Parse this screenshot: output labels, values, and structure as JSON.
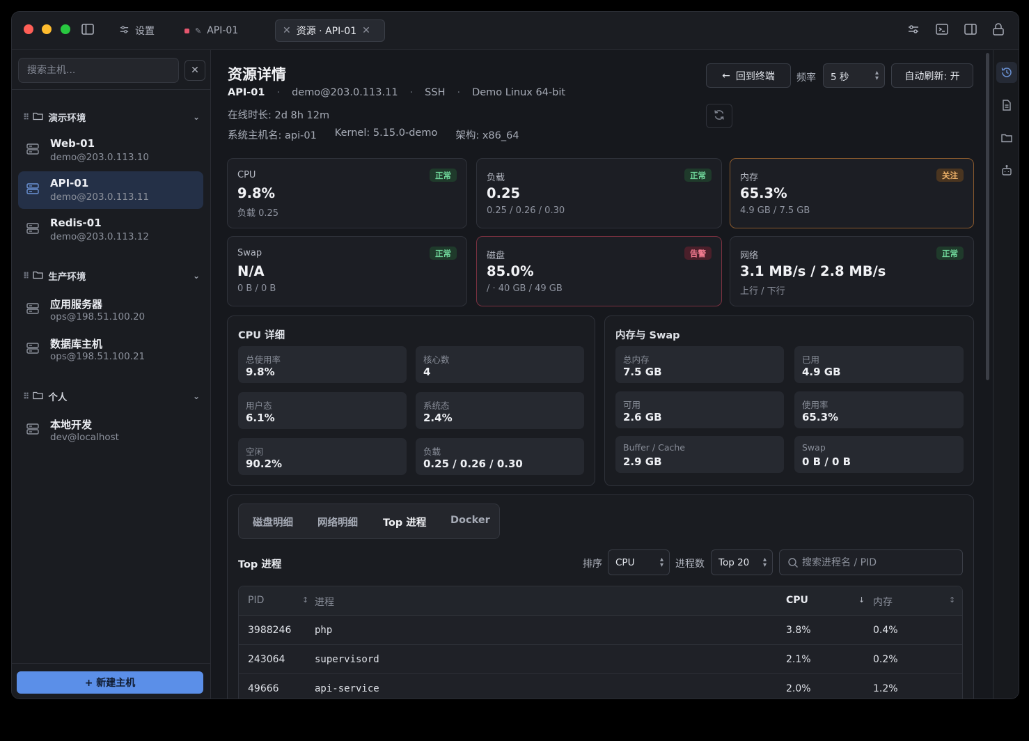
{
  "titlebar": {
    "tabs": [
      {
        "label": "设置"
      },
      {
        "label": "API-01"
      },
      {
        "label": "资源 · API-01"
      }
    ]
  },
  "sidebar": {
    "search_placeholder": "搜索主机...",
    "groups": [
      {
        "name": "演示环境",
        "hosts": [
          {
            "name": "Web-01",
            "addr": "demo@203.0.113.10"
          },
          {
            "name": "API-01",
            "addr": "demo@203.0.113.11"
          },
          {
            "name": "Redis-01",
            "addr": "demo@203.0.113.12"
          }
        ]
      },
      {
        "name": "生产环境",
        "hosts": [
          {
            "name": "应用服务器",
            "addr": "ops@198.51.100.20"
          },
          {
            "name": "数据库主机",
            "addr": "ops@198.51.100.21"
          }
        ]
      },
      {
        "name": "个人",
        "hosts": [
          {
            "name": "本地开发",
            "addr": "dev@localhost"
          }
        ]
      }
    ],
    "new_host_label": "+ 新建主机"
  },
  "header": {
    "title": "资源详情",
    "host": "API-01",
    "user_addr": "demo@203.0.113.11",
    "protocol": "SSH",
    "os": "Demo Linux 64-bit",
    "uptime": "在线时长: 2d 8h 12m",
    "hostname": "系统主机名: api-01",
    "kernel": "Kernel: 5.15.0-demo",
    "arch": "架构: x86_64",
    "back_label": "回到终端",
    "freq_label": "频率",
    "freq_value": "5 秒",
    "auto_refresh_label": "自动刷新: 开"
  },
  "cards": [
    {
      "label": "CPU",
      "value": "9.8%",
      "sub": "负载 0.25",
      "badge": "正常",
      "status": "ok"
    },
    {
      "label": "负载",
      "value": "0.25",
      "sub": "0.25 / 0.26 / 0.30",
      "badge": "正常",
      "status": "ok"
    },
    {
      "label": "内存",
      "value": "65.3%",
      "sub": "4.9 GB / 7.5 GB",
      "badge": "关注",
      "status": "warn"
    },
    {
      "label": "Swap",
      "value": "N/A",
      "sub": "0 B / 0 B",
      "badge": "正常",
      "status": "ok"
    },
    {
      "label": "磁盘",
      "value": "85.0%",
      "sub": "/ · 40 GB / 49 GB",
      "badge": "告警",
      "status": "alert"
    },
    {
      "label": "网络",
      "value": "3.1 MB/s / 2.8 MB/s",
      "sub": "上行 / 下行",
      "badge": "正常",
      "status": "ok"
    }
  ],
  "cpu_detail": {
    "title": "CPU 详细",
    "stats": [
      {
        "k": "总使用率",
        "v": "9.8%"
      },
      {
        "k": "核心数",
        "v": "4"
      },
      {
        "k": "用户态",
        "v": "6.1%"
      },
      {
        "k": "系统态",
        "v": "2.4%"
      },
      {
        "k": "空闲",
        "v": "90.2%"
      },
      {
        "k": "负载",
        "v": "0.25 / 0.26 / 0.30"
      }
    ]
  },
  "mem_detail": {
    "title": "内存与 Swap",
    "stats": [
      {
        "k": "总内存",
        "v": "7.5 GB"
      },
      {
        "k": "已用",
        "v": "4.9 GB"
      },
      {
        "k": "可用",
        "v": "2.6 GB"
      },
      {
        "k": "使用率",
        "v": "65.3%"
      },
      {
        "k": "Buffer / Cache",
        "v": "2.9 GB"
      },
      {
        "k": "Swap",
        "v": "0 B / 0 B"
      }
    ]
  },
  "process_panel": {
    "tabs": [
      "磁盘明细",
      "网络明细",
      "Top 进程",
      "Docker"
    ],
    "active_tab": "Top 进程",
    "title": "Top 进程",
    "sort_label": "排序",
    "sort_value": "CPU",
    "count_label": "进程数",
    "count_value": "Top 20",
    "search_placeholder": "搜索进程名 / PID",
    "columns": [
      "PID",
      "进程",
      "CPU",
      "内存"
    ],
    "rows": [
      {
        "pid": "3988246",
        "name": "php",
        "cpu": "3.8%",
        "mem": "0.4%"
      },
      {
        "pid": "243064",
        "name": "supervisord",
        "cpu": "2.1%",
        "mem": "0.2%"
      },
      {
        "pid": "49666",
        "name": "api-service",
        "cpu": "2.0%",
        "mem": "1.2%"
      }
    ]
  },
  "colors": {
    "accent": "#5b8fe8",
    "ok": "#6fd69a",
    "warn": "#f2b56b",
    "alert": "#f27a8f"
  }
}
